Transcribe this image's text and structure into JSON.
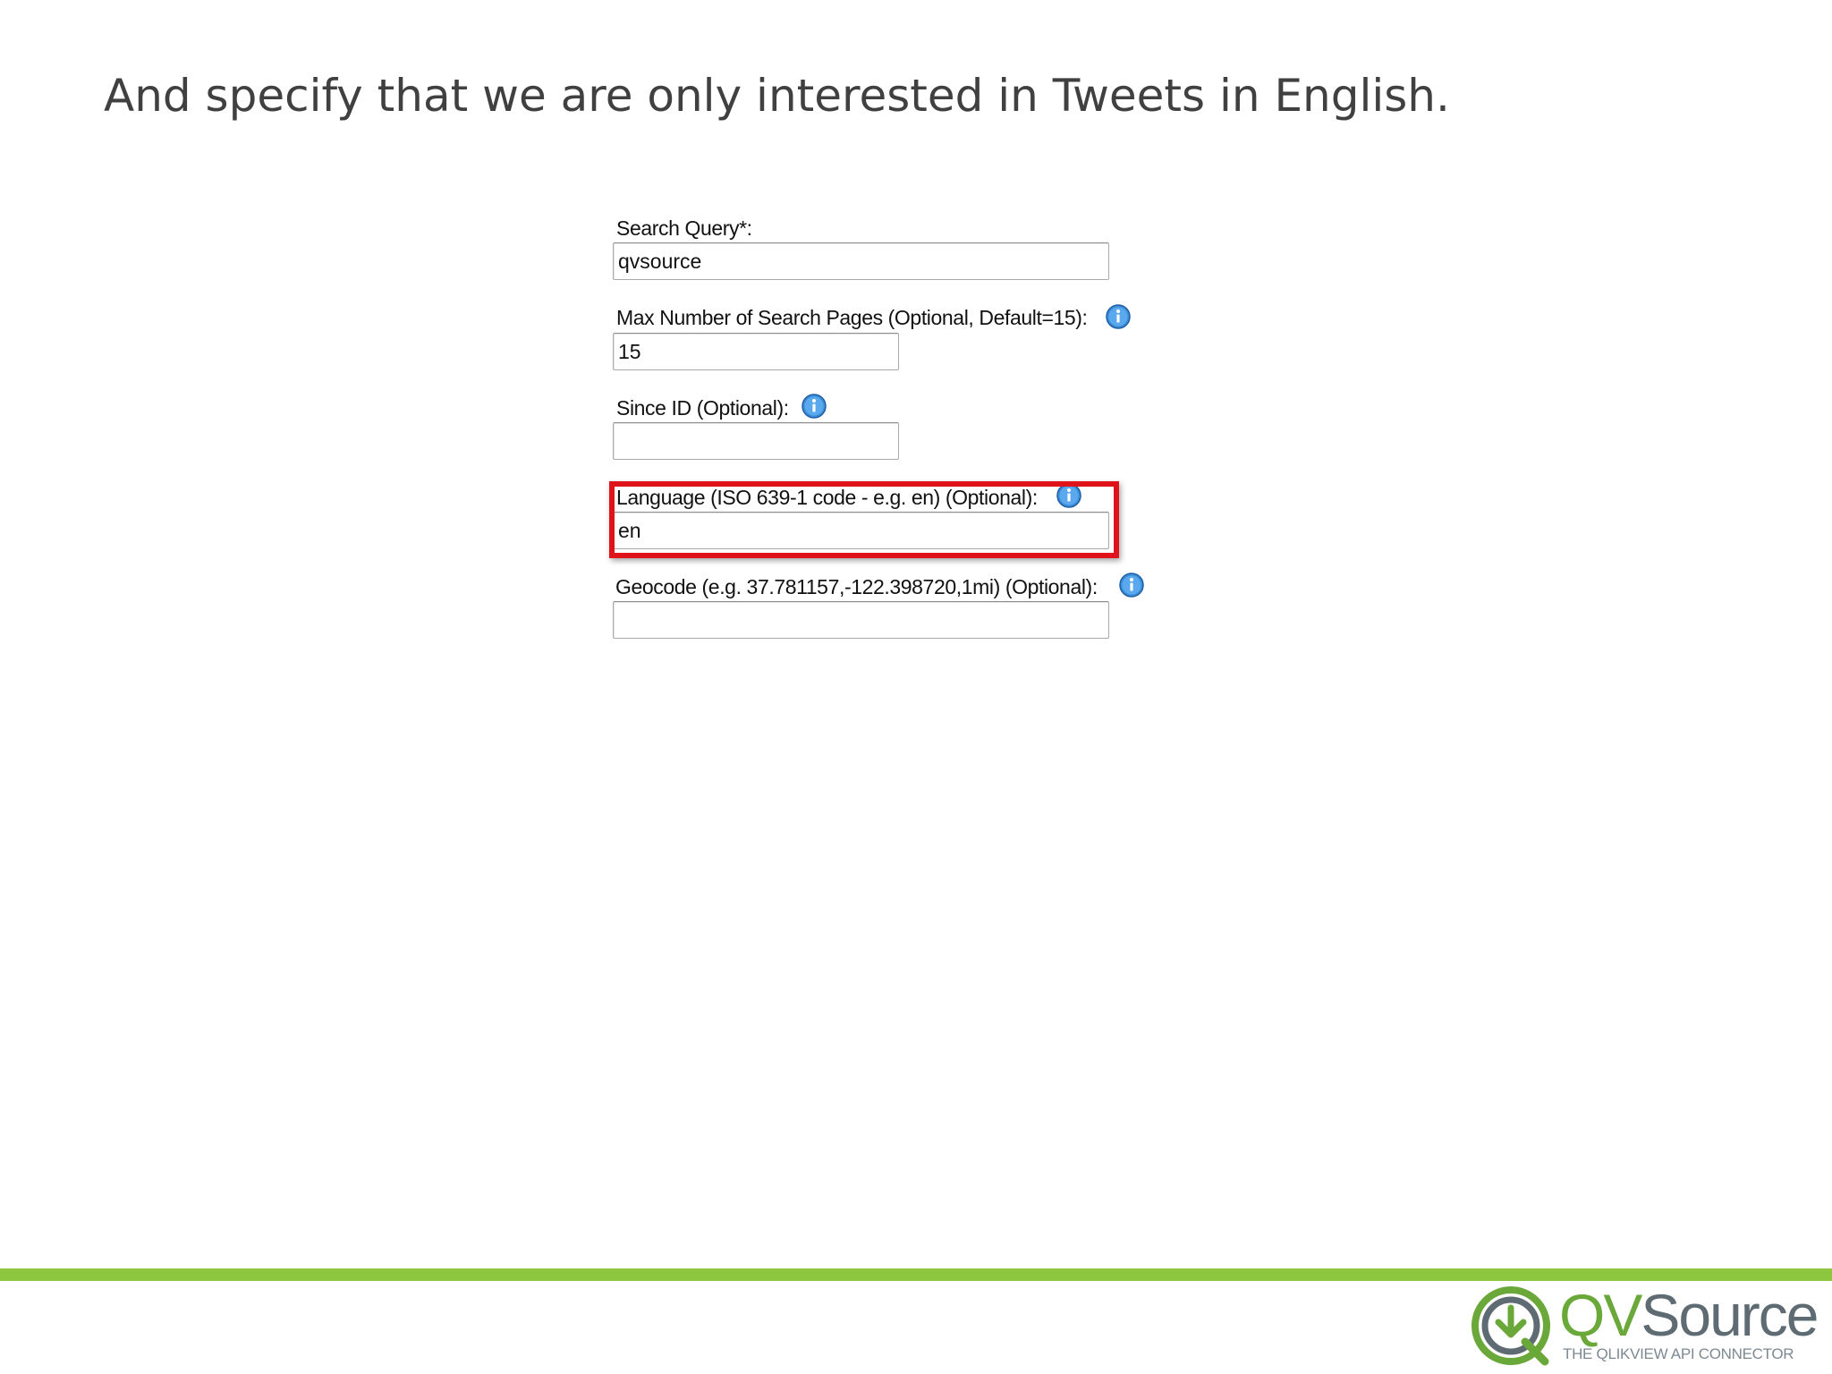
{
  "slide": {
    "title": "And specify that we are only interested in Tweets in English."
  },
  "form": {
    "search_query": {
      "label": "Search Query*:",
      "value": "qvsource"
    },
    "max_pages": {
      "label": "Max Number of Search Pages (Optional, Default=15):",
      "value": "15"
    },
    "since_id": {
      "label": "Since ID (Optional):",
      "value": ""
    },
    "language": {
      "label": "Language (ISO 639-1 code - e.g. en) (Optional):",
      "value": "en"
    },
    "geocode": {
      "label": "Geocode (e.g. 37.781157,-122.398720,1mi) (Optional):",
      "value": ""
    }
  },
  "icons": {
    "info": "info-icon"
  },
  "highlight": {
    "color": "#e0121a",
    "target": "language"
  },
  "footer": {
    "bar_color": "#8dc63f",
    "logo_qv": "QV",
    "logo_source": "Source",
    "logo_tagline": "THE QLIKVIEW API CONNECTOR"
  },
  "colors": {
    "title_text": "#404040",
    "info_icon": "#3d8fd8",
    "logo_green": "#6aa83a",
    "logo_gray": "#5e6b73"
  }
}
